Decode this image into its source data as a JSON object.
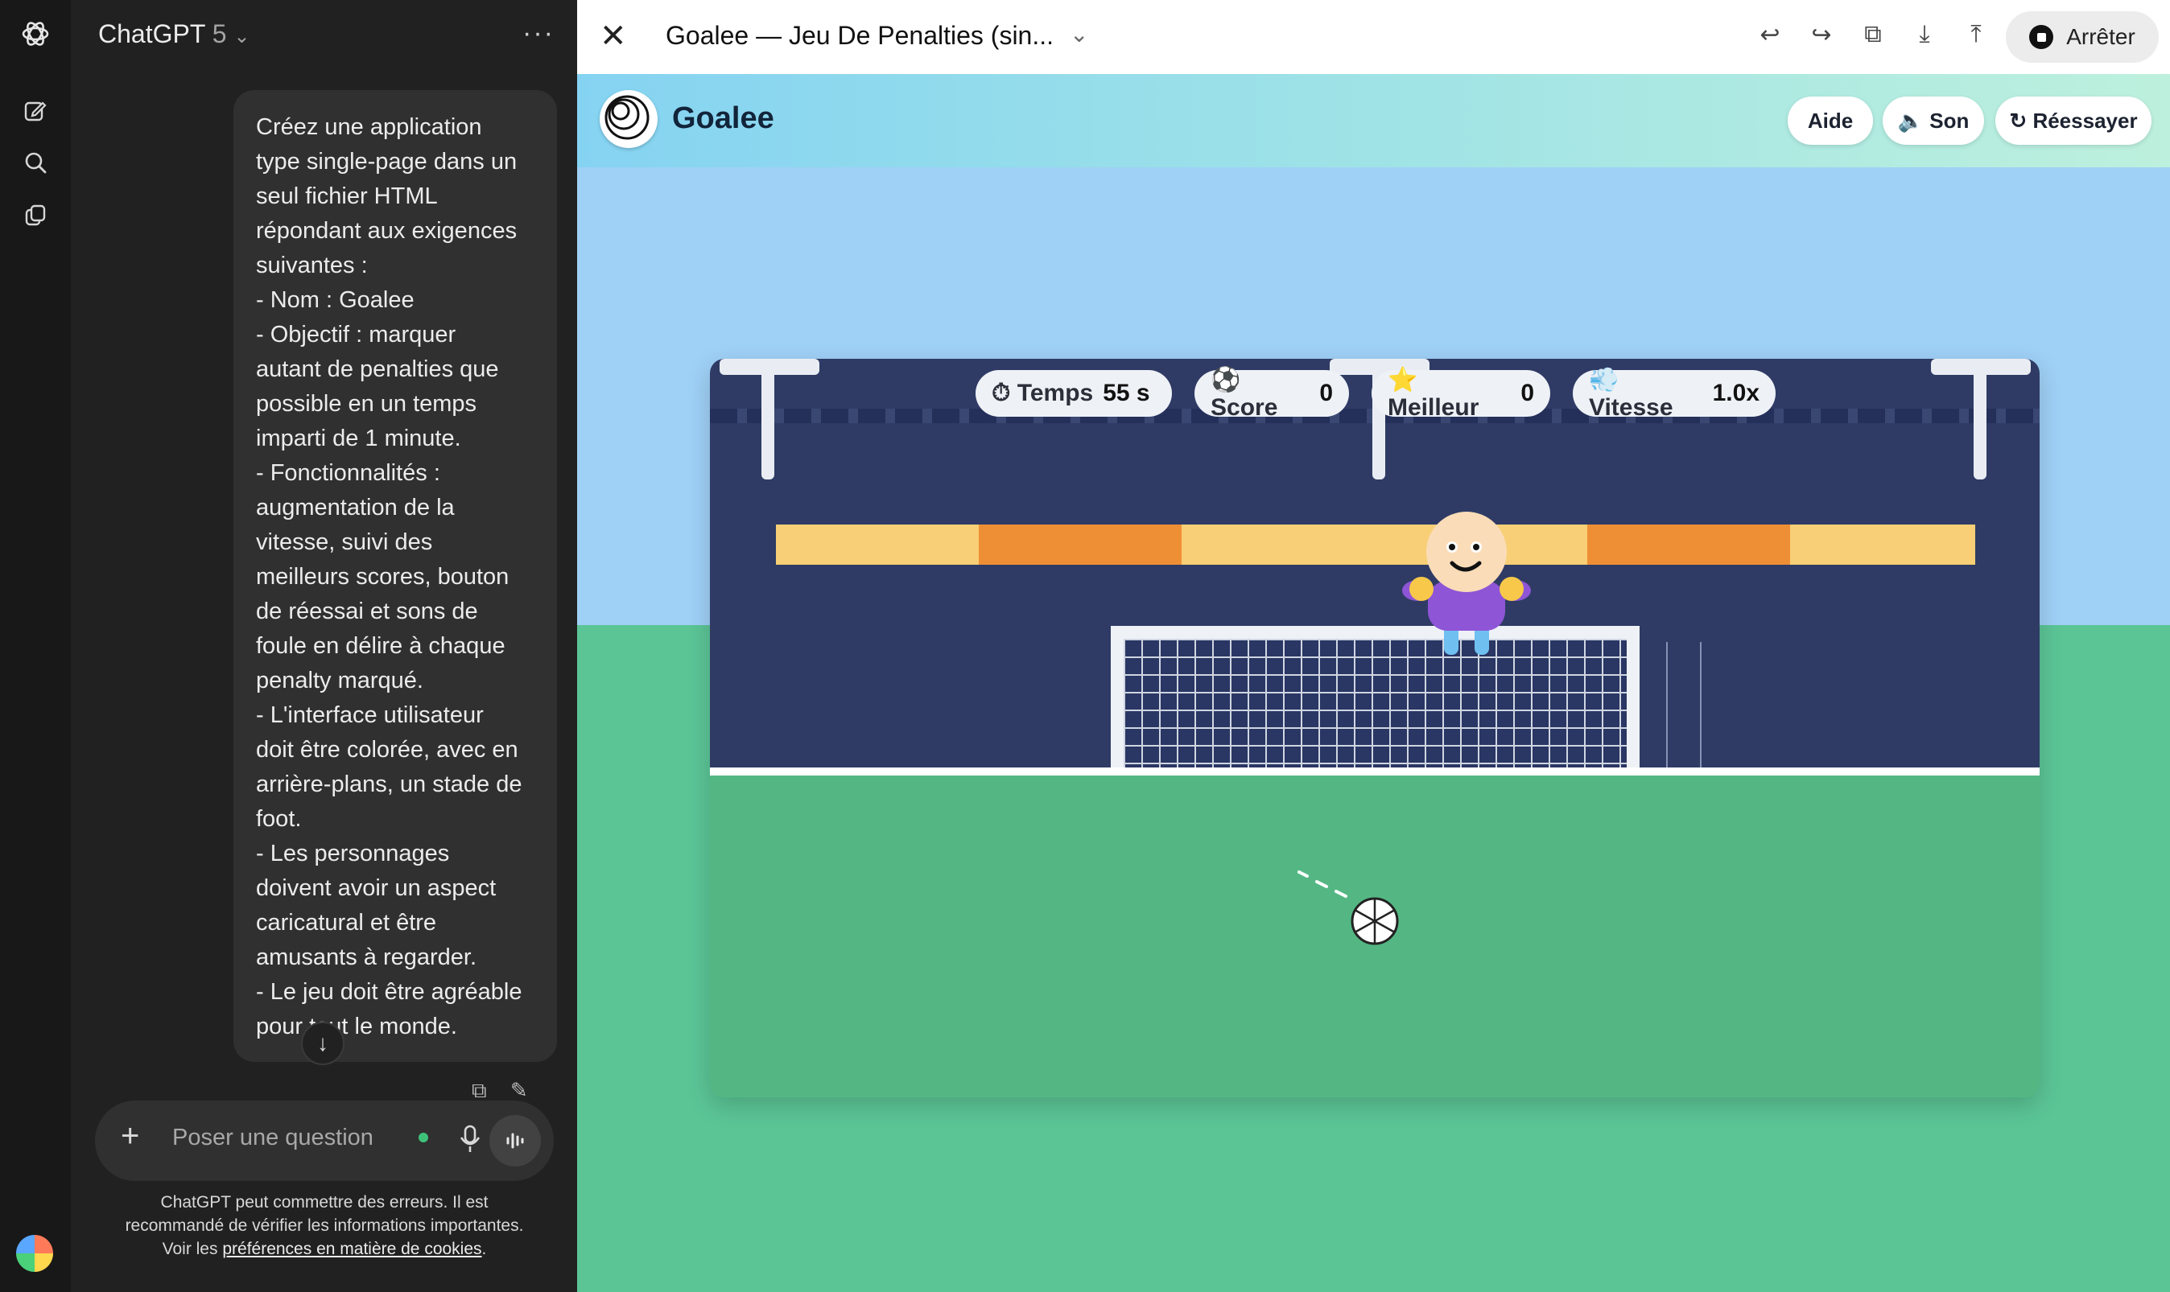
{
  "sidebar": {
    "icons": [
      "openai-logo-icon",
      "new-chat-icon",
      "search-icon",
      "library-icon"
    ]
  },
  "chat": {
    "model_name": "ChatGPT",
    "model_version": "5",
    "more_label": "···",
    "message_lines": [
      "Créez une application",
      "type single-page dans un",
      "seul fichier HTML",
      "répondant aux exigences",
      "suivantes :",
      "- Nom : Goalee",
      "- Objectif : marquer",
      "autant de penalties que",
      "possible en un temps",
      "imparti de 1 minute.",
      "- Fonctionnalités :",
      "augmentation de la",
      "vitesse, suivi des",
      "meilleurs scores, bouton",
      "de réessai et sons de",
      "foule en délire à chaque",
      "penalty marqué.",
      "- L'interface utilisateur",
      "doit être colorée, avec en",
      "arrière-plans, un stade de",
      "foot.",
      "- Les personnages",
      "doivent avoir un aspect",
      "caricatural et être",
      "amusants à regarder.",
      "- Le jeu doit être agréable",
      "pour tout le monde."
    ],
    "composer_placeholder": "Poser une question",
    "disclaimer_text": "ChatGPT peut commettre des erreurs. Il est recommandé de vérifier les informations importantes. Voir les",
    "disclaimer_link": "préférences en matière de cookies",
    "disclaimer_end": "."
  },
  "canvas_header": {
    "title": "Goalee — Jeu De Penalties (sin...",
    "stop_label": "Arrêter"
  },
  "app": {
    "brand": "Goalee",
    "buttons": {
      "help": "Aide",
      "sound": "🔈 Son",
      "retry": "↻ Réessayer"
    },
    "hud": {
      "time_label": "⏱ Temps",
      "time_value": "55 s",
      "score_label": "⚽ Score",
      "score_value": "0",
      "best_label": "⭐ Meilleur",
      "best_value": "0",
      "speed_label": "💨 Vitesse",
      "speed_value": "1.0x"
    }
  },
  "colors": {
    "accent_dark": "#212121",
    "sky": "#9fd0f6",
    "grass": "#5bc596",
    "stands": "#2f3b65",
    "banner_orange": "#ef8f35",
    "banner_yellow": "#f8cf76"
  }
}
